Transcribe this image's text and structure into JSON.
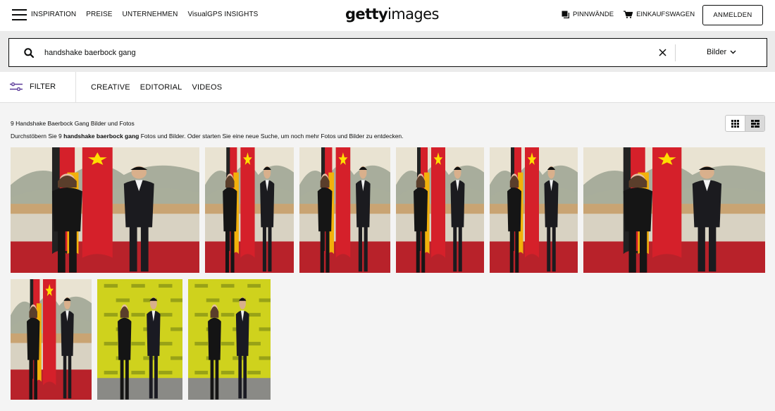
{
  "nav": {
    "links": [
      "INSPIRATION",
      "PREISE",
      "UNTERNEHMEN",
      "VisualGPS INSIGHTS"
    ],
    "logo_bold": "getty",
    "logo_light": "images",
    "boards_label": "PINNWÄNDE",
    "cart_label": "EINKAUFSWAGEN",
    "login_label": "ANMELDEN"
  },
  "search": {
    "query": "handshake baerbock gang",
    "type_label": "Bilder"
  },
  "filter": {
    "filter_label": "FILTER",
    "tabs": [
      "CREATIVE",
      "EDITORIAL",
      "VIDEOS"
    ]
  },
  "results": {
    "title": "9 Handshake Baerbock Gang Bilder und Fotos",
    "desc_prefix": "Durchstöbern Sie 9 ",
    "desc_bold": "handshake baerbock gang",
    "desc_suffix": " Fotos und Bilder. Oder starten Sie eine neue Suche, um noch mehr Fotos und Bilder zu entdecken."
  },
  "colors": {
    "flag_red": "#d5202a",
    "flag_gold": "#f2b10b",
    "carpet_red": "#b8222a",
    "backdrop_yellow": "#cfd21d",
    "accent_purple": "#5c3b9a"
  },
  "images": [
    {
      "scene": "mural",
      "variant": "wide"
    },
    {
      "scene": "mural",
      "variant": "square"
    },
    {
      "scene": "mural",
      "variant": "square"
    },
    {
      "scene": "mural",
      "variant": "square"
    },
    {
      "scene": "mural",
      "variant": "square"
    },
    {
      "scene": "mural",
      "variant": "wide"
    },
    {
      "scene": "mural",
      "variant": "portrait"
    },
    {
      "scene": "yellow",
      "variant": "portrait"
    },
    {
      "scene": "yellow",
      "variant": "portrait"
    }
  ]
}
